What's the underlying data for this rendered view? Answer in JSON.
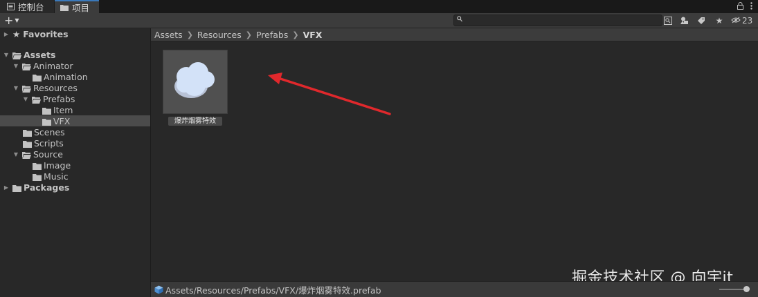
{
  "tabs": [
    {
      "label": "控制台",
      "icon": "console-icon"
    },
    {
      "label": "项目",
      "icon": "folder-icon"
    }
  ],
  "toolbar": {
    "create_label": "+",
    "search_placeholder": "",
    "hidden_count": "23"
  },
  "tree": {
    "favorites": "Favorites",
    "assets": "Assets",
    "animator": "Animator",
    "animation": "Animation",
    "resources": "Resources",
    "prefabs": "Prefabs",
    "item": "Item",
    "vfx": "VFX",
    "scenes": "Scenes",
    "scripts": "Scripts",
    "source": "Source",
    "image": "Image",
    "music": "Music",
    "packages": "Packages"
  },
  "breadcrumb": [
    "Assets",
    "Resources",
    "Prefabs",
    "VFX"
  ],
  "asset": {
    "name": "爆炸烟雾特效"
  },
  "status": {
    "path": "Assets/Resources/Prefabs/VFX/爆炸烟雾特效.prefab"
  },
  "watermark": "掘金技术社区 @ 向宇it",
  "colors": {
    "accent_tab": "#3a79bb",
    "arrow": "#e0282c",
    "folder": "#c2c2c2",
    "selection": "#4b4b4b"
  }
}
